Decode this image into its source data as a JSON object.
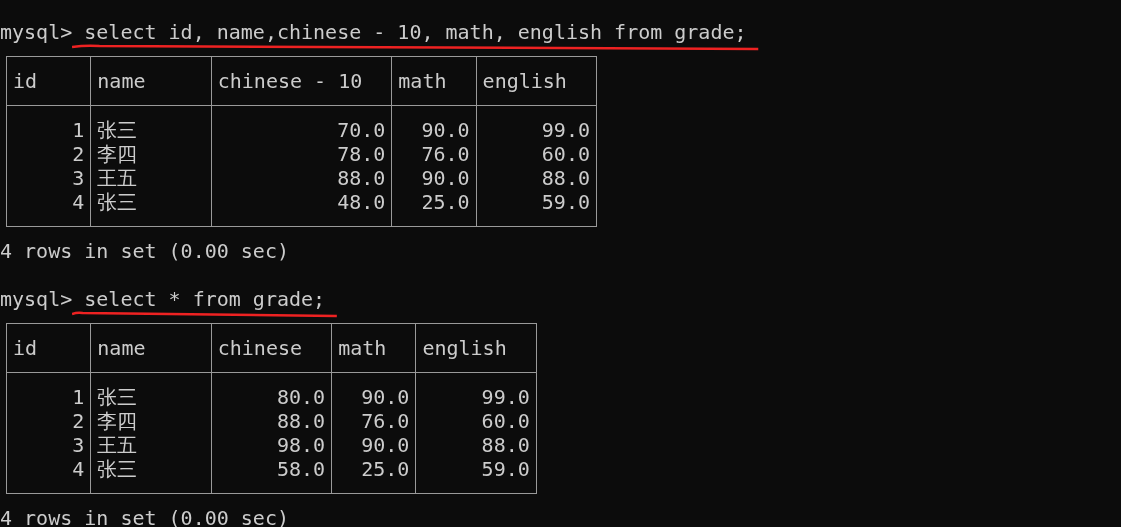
{
  "blocks": [
    {
      "prompt": "mysql>",
      "command": "select id, name,chinese - 10, math, english from grade;",
      "underlined": true,
      "columns": [
        {
          "label": "id",
          "kind": "number"
        },
        {
          "label": "name",
          "kind": "text"
        },
        {
          "label": "chinese - 10",
          "kind": "number"
        },
        {
          "label": "math",
          "kind": "number"
        },
        {
          "label": "english",
          "kind": "number"
        }
      ],
      "rows": [
        [
          "1",
          "张三",
          "70.0",
          "90.0",
          "99.0"
        ],
        [
          "2",
          "李四",
          "78.0",
          "76.0",
          "60.0"
        ],
        [
          "3",
          "王五",
          "88.0",
          "90.0",
          "88.0"
        ],
        [
          "4",
          "张三",
          "48.0",
          "25.0",
          "59.0"
        ]
      ],
      "summary": "4 rows in set (0.00 sec)"
    },
    {
      "prompt": "mysql>",
      "command": "select * from grade;",
      "underlined": true,
      "columns": [
        {
          "label": "id",
          "kind": "number"
        },
        {
          "label": "name",
          "kind": "text"
        },
        {
          "label": "chinese",
          "kind": "number"
        },
        {
          "label": "math",
          "kind": "number"
        },
        {
          "label": "english",
          "kind": "number"
        }
      ],
      "rows": [
        [
          "1",
          "张三",
          "80.0",
          "90.0",
          "99.0"
        ],
        [
          "2",
          "李四",
          "88.0",
          "76.0",
          "60.0"
        ],
        [
          "3",
          "王五",
          "98.0",
          "90.0",
          "88.0"
        ],
        [
          "4",
          "张三",
          "58.0",
          "25.0",
          "59.0"
        ]
      ],
      "summary": "4 rows in set (0.00 sec)"
    }
  ]
}
